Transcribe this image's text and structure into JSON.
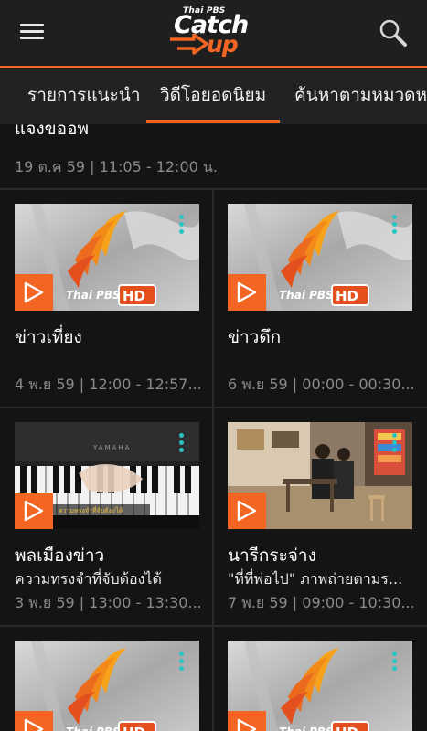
{
  "header": {
    "logo_small": "Thai PBS",
    "logo_main": "Catch",
    "logo_sub": "up",
    "accent_color": "#f26522",
    "menu_icon": "hamburger-menu-icon",
    "search_icon": "magnifier-search-icon"
  },
  "tabs": [
    {
      "label": "รายการแนะนำ"
    },
    {
      "label": "วิดีโอยอดนิยม"
    },
    {
      "label": "ค้นหาตามหมวดหมู่"
    }
  ],
  "partial_item": {
    "title": "แจงข้ออัพ",
    "meta": "19 ต.ค 59 | 11:05 - 12:00 น."
  },
  "videos": [
    {
      "title": "ข่าวเที่ยง",
      "subtitle": "",
      "meta": "4 พ.ย 59 | 12:00 - 12:57...",
      "thumb": "thaipbs-hd-logo"
    },
    {
      "title": "ข่าวดึก",
      "subtitle": "",
      "meta": "6 พ.ย 59 | 00:00 - 00:30...",
      "thumb": "thaipbs-hd-logo"
    },
    {
      "title": "พลเมืองข่าว",
      "subtitle": "ความทรงจำที่จับต้องได้",
      "meta": "3 พ.ย 59 | 13:00 - 13:30...",
      "thumb": "piano-keys",
      "thumb_caption": "ความทรงจำที่จับต้องได้"
    },
    {
      "title": "นารีกระจ่าง",
      "subtitle": "\"ที่ที่พ่อไป\" ภาพถ่ายตามร...",
      "meta": "7 พ.ย 59 | 09:00 - 10:30...",
      "thumb": "studio-set"
    },
    {
      "title": "",
      "subtitle": "",
      "meta": "",
      "thumb": "thaipbs-hd-logo"
    },
    {
      "title": "",
      "subtitle": "",
      "meta": "",
      "thumb": "thaipbs-hd-logo"
    }
  ],
  "thumb_brand": {
    "name": "Thai PBS",
    "badge": "HD"
  }
}
